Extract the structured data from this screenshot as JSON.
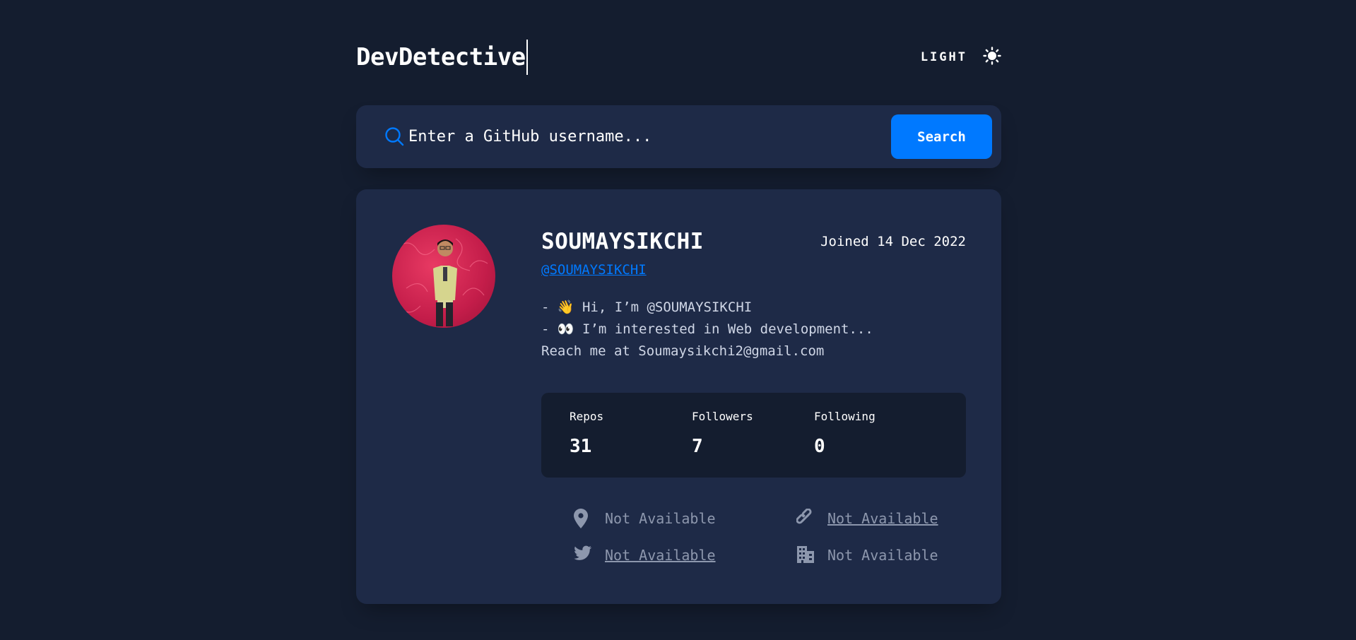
{
  "header": {
    "logo": "DevDetective",
    "mode_label": "LIGHT",
    "mode_icon": "sun-icon"
  },
  "search": {
    "placeholder": "Enter a GitHub username...",
    "button_label": "Search",
    "icon": "search-icon"
  },
  "profile": {
    "name": "SOUMAYSIKCHI",
    "joined": "Joined 14 Dec 2022",
    "handle": "@SOUMAYSIKCHI",
    "bio_lines": [
      "- 👋 Hi, I’m @SOUMAYSIKCHI",
      "- 👀 I’m interested in Web development...",
      "Reach me at Soumaysikchi2@gmail.com"
    ],
    "stats": {
      "repos_label": "Repos",
      "repos_value": "31",
      "followers_label": "Followers",
      "followers_value": "7",
      "following_label": "Following",
      "following_value": "0"
    },
    "links": {
      "location": "Not Available",
      "website": "Not Available",
      "twitter": "Not Available",
      "company": "Not Available"
    }
  },
  "colors": {
    "background": "#141d2f",
    "card": "#1e2a47",
    "accent": "#0079ff",
    "muted": "#8d97ad"
  }
}
